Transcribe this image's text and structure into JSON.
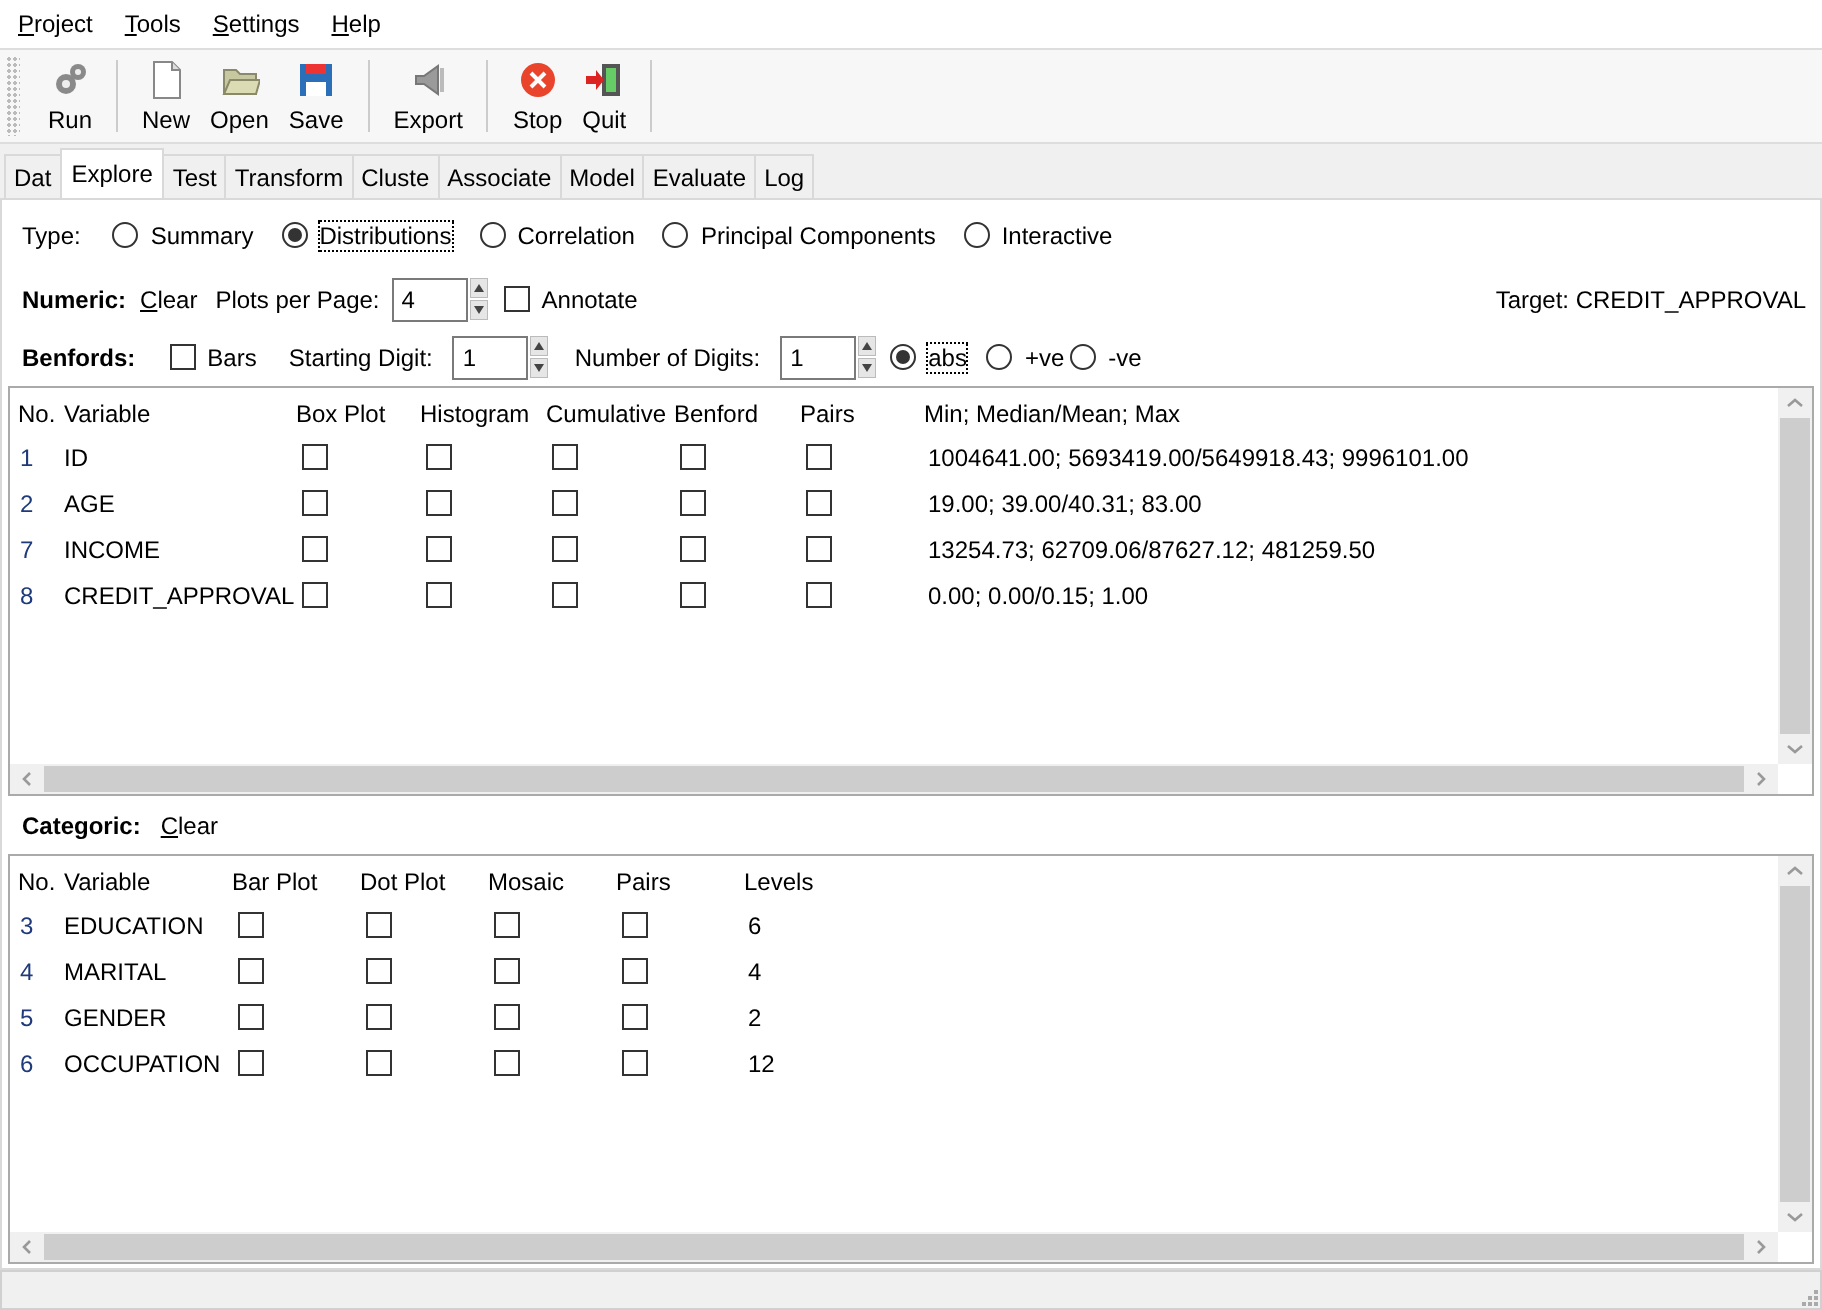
{
  "menu": [
    {
      "label": "Project"
    },
    {
      "label": "Tools"
    },
    {
      "label": "Settings"
    },
    {
      "label": "Help"
    }
  ],
  "toolbar": {
    "groups": [
      [
        {
          "label": "Run",
          "kind": "run"
        }
      ],
      [
        {
          "label": "New",
          "kind": "new"
        },
        {
          "label": "Open",
          "kind": "open"
        },
        {
          "label": "Save",
          "kind": "save"
        }
      ],
      [
        {
          "label": "Export",
          "kind": "export"
        }
      ],
      [
        {
          "label": "Stop",
          "kind": "stop"
        },
        {
          "label": "Quit",
          "kind": "quit"
        }
      ]
    ]
  },
  "tabs": [
    {
      "label": "Dat",
      "selected": false
    },
    {
      "label": "Explore",
      "selected": true
    },
    {
      "label": "Test",
      "selected": false
    },
    {
      "label": "Transform",
      "selected": false
    },
    {
      "label": "Cluste",
      "selected": false
    },
    {
      "label": "Associate",
      "selected": false
    },
    {
      "label": "Model",
      "selected": false
    },
    {
      "label": "Evaluate",
      "selected": false
    },
    {
      "label": "Log",
      "selected": false
    }
  ],
  "type": {
    "label": "Type:",
    "options": [
      {
        "label": "Summary",
        "selected": false
      },
      {
        "label": "Distributions",
        "selected": true
      },
      {
        "label": "Correlation",
        "selected": false
      },
      {
        "label": "Principal Components",
        "selected": false
      },
      {
        "label": "Interactive",
        "selected": false
      }
    ]
  },
  "numeric": {
    "label": "Numeric:",
    "clear": "Clear",
    "plots_per_page": {
      "label": "Plots per Page:",
      "value": "4"
    },
    "annotate": {
      "label": "Annotate",
      "checked": false
    },
    "target": "Target: CREDIT_APPROVAL"
  },
  "benfords": {
    "label": "Benfords:",
    "bars": {
      "label": "Bars",
      "checked": false
    },
    "starting_digit": {
      "label": "Starting Digit:",
      "value": "1"
    },
    "number_of_digits": {
      "label": "Number of Digits:",
      "value": "1"
    },
    "sign": [
      {
        "label": "abs",
        "selected": true
      },
      {
        "label": "+ve",
        "selected": false
      },
      {
        "label": "-ve",
        "selected": false
      }
    ]
  },
  "numeric_table": {
    "columns": [
      "No.",
      "Variable",
      "Box Plot",
      "Histogram",
      "Cumulative",
      "Benford",
      "Pairs",
      "Min; Median/Mean; Max"
    ],
    "rows": [
      {
        "no": "1",
        "variable": "ID",
        "checks": [
          {
            "checked": false
          },
          {
            "checked": false
          },
          {
            "checked": false
          },
          {
            "checked": false
          },
          {
            "checked": false
          }
        ],
        "summary": "1004641.00; 5693419.00/5649918.43; 9996101.00"
      },
      {
        "no": "2",
        "variable": "AGE",
        "checks": [
          {
            "checked": false
          },
          {
            "checked": false
          },
          {
            "checked": false
          },
          {
            "checked": false
          },
          {
            "checked": false
          }
        ],
        "summary": "19.00; 39.00/40.31; 83.00"
      },
      {
        "no": "7",
        "variable": "INCOME",
        "checks": [
          {
            "checked": false
          },
          {
            "checked": false
          },
          {
            "checked": false
          },
          {
            "checked": false
          },
          {
            "checked": false
          }
        ],
        "summary": "13254.73; 62709.06/87627.12; 481259.50"
      },
      {
        "no": "8",
        "variable": "CREDIT_APPROVAL",
        "checks": [
          {
            "checked": false
          },
          {
            "checked": false
          },
          {
            "checked": false
          },
          {
            "checked": false
          },
          {
            "checked": false
          }
        ],
        "summary": "0.00; 0.00/0.15; 1.00"
      }
    ]
  },
  "categoric": {
    "label": "Categoric:",
    "clear": "Clear"
  },
  "categoric_table": {
    "columns": [
      "No.",
      "Variable",
      "Bar Plot",
      "Dot Plot",
      "Mosaic",
      "Pairs",
      "Levels"
    ],
    "rows": [
      {
        "no": "3",
        "variable": "EDUCATION",
        "checks": [
          {
            "checked": false
          },
          {
            "checked": false
          },
          {
            "checked": false
          },
          {
            "checked": false
          }
        ],
        "levels": "6"
      },
      {
        "no": "4",
        "variable": "MARITAL",
        "checks": [
          {
            "checked": false
          },
          {
            "checked": false
          },
          {
            "checked": false
          },
          {
            "checked": false
          }
        ],
        "levels": "4"
      },
      {
        "no": "5",
        "variable": "GENDER",
        "checks": [
          {
            "checked": false
          },
          {
            "checked": false
          },
          {
            "checked": false
          },
          {
            "checked": false
          }
        ],
        "levels": "2"
      },
      {
        "no": "6",
        "variable": "OCCUPATION",
        "checks": [
          {
            "checked": false
          },
          {
            "checked": false
          },
          {
            "checked": false
          },
          {
            "checked": false
          }
        ],
        "levels": "12"
      }
    ]
  }
}
